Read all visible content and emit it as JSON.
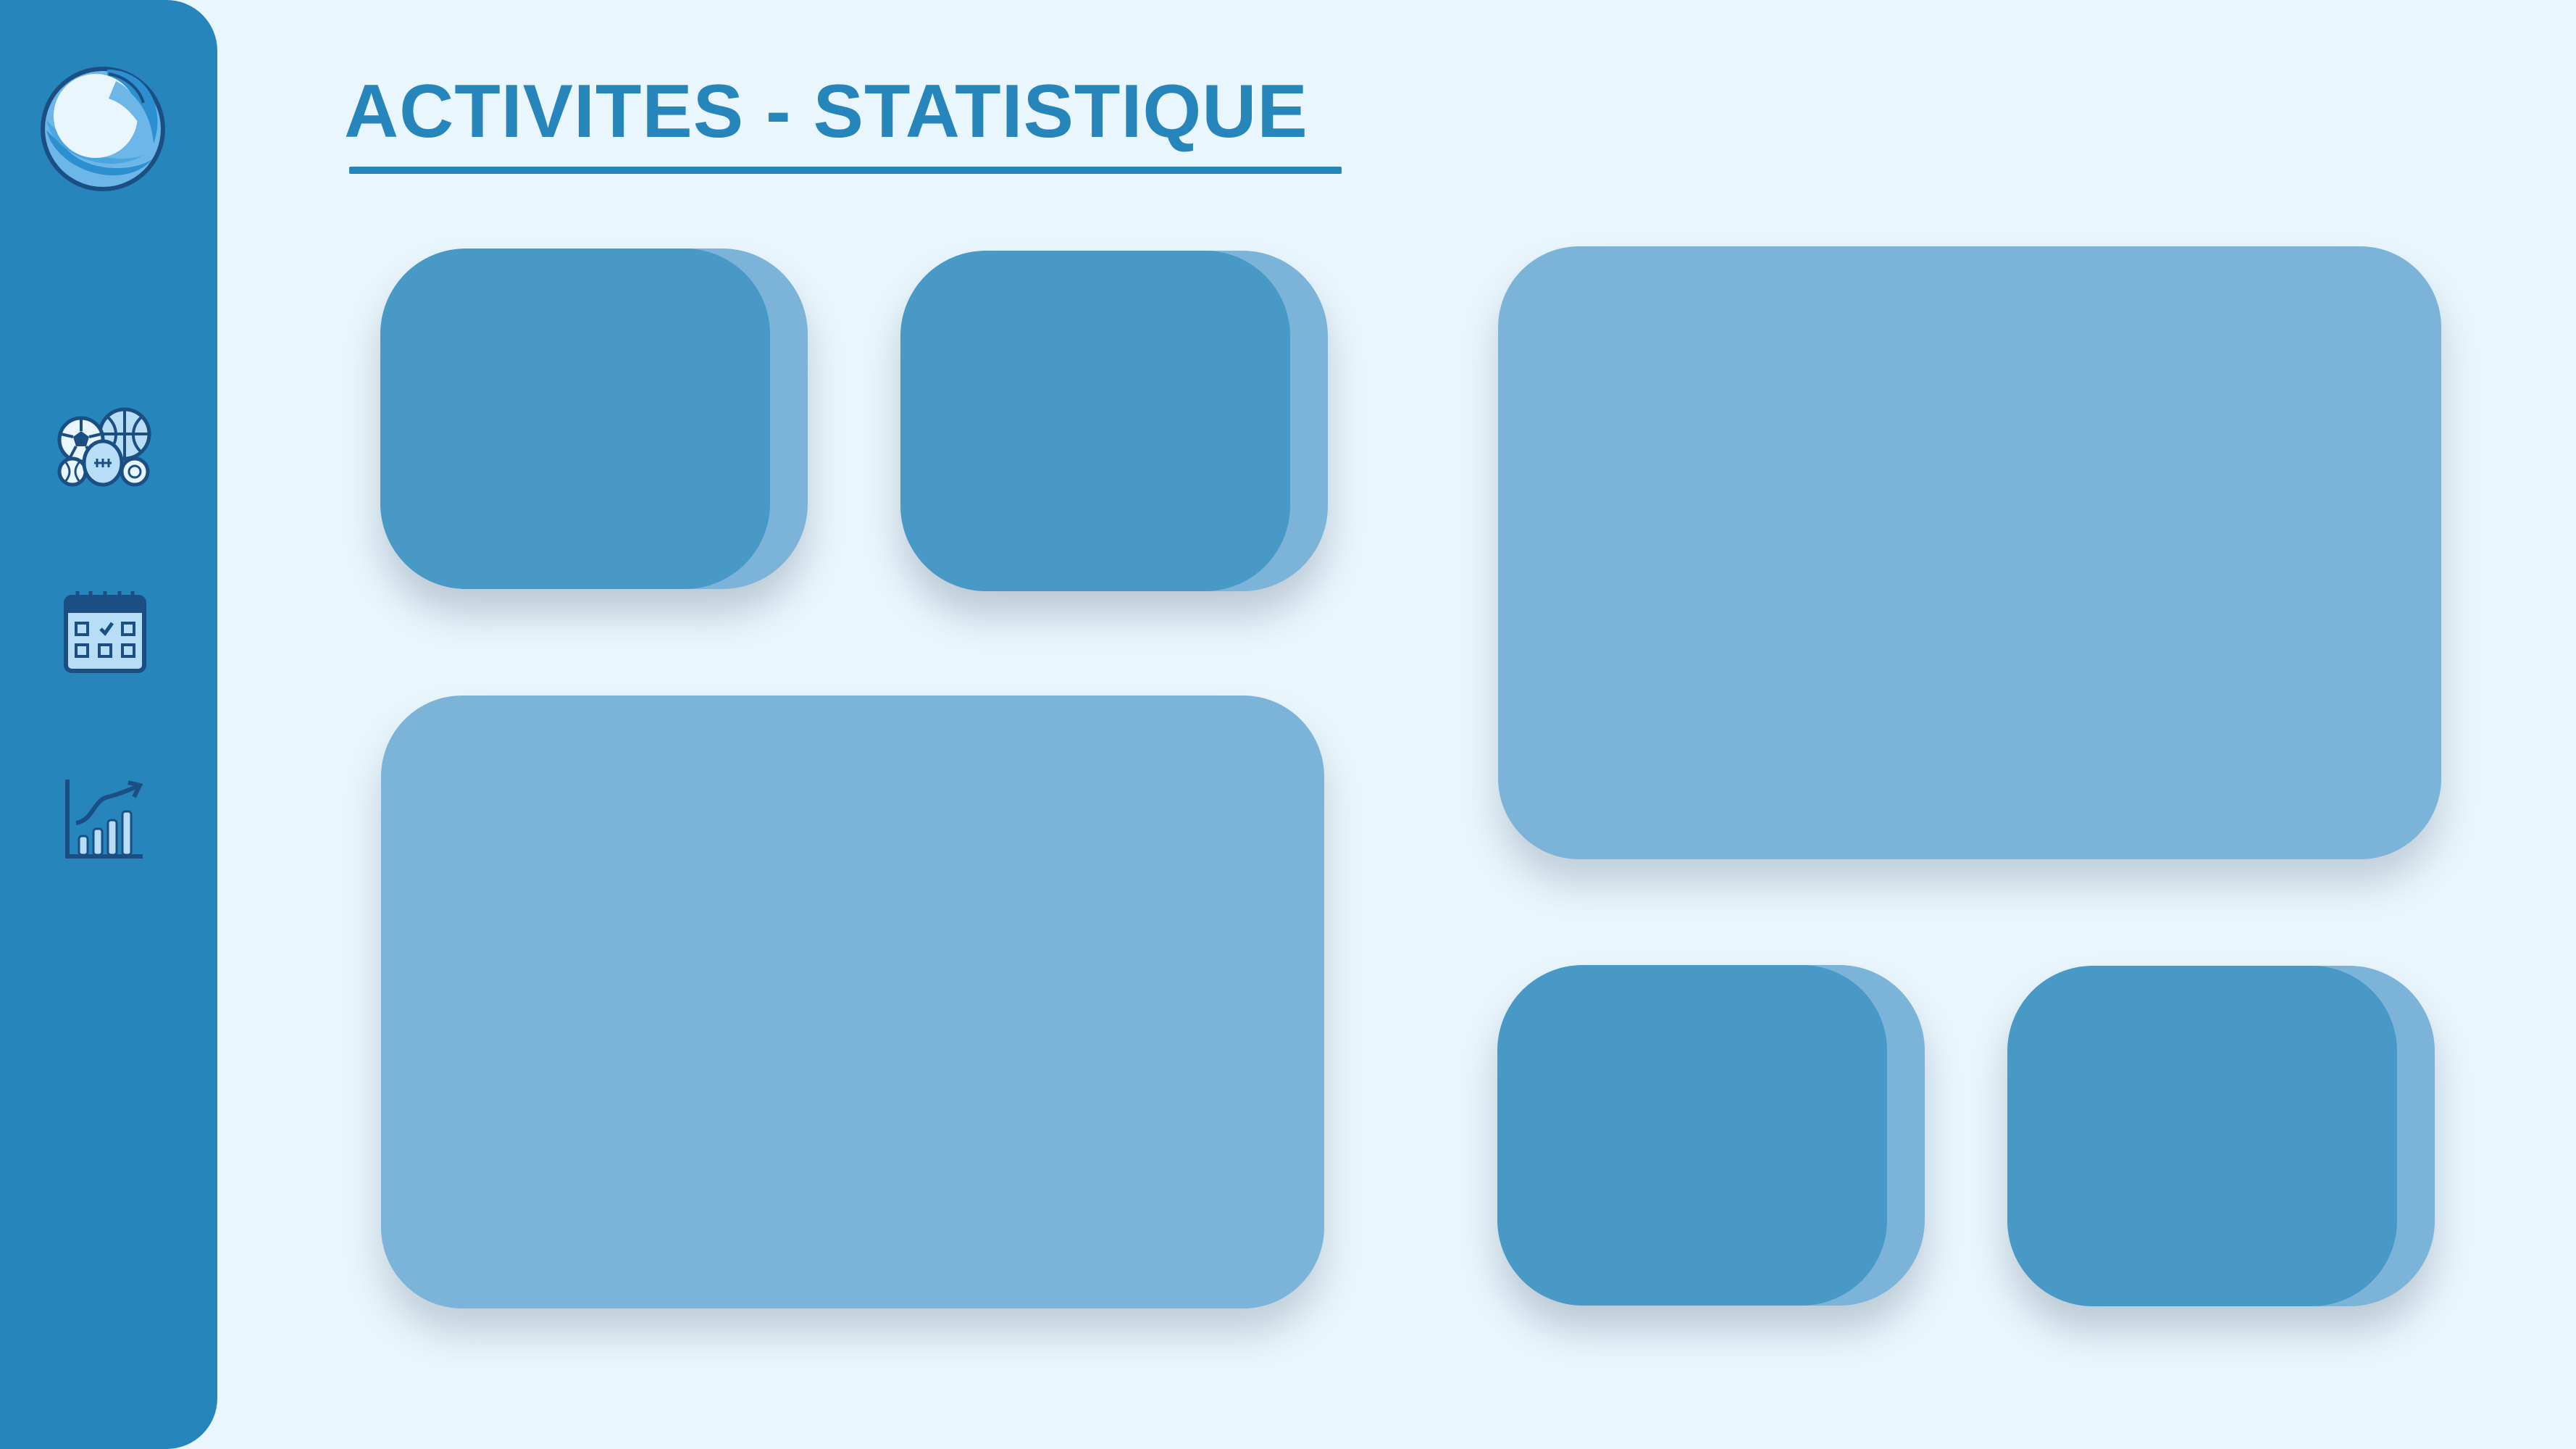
{
  "page": {
    "title": "ACTIVITES - STATISTIQUE"
  },
  "sidebar": {
    "logo_icon": "wave-logo-icon",
    "items": [
      {
        "icon": "sports-balls-icon"
      },
      {
        "icon": "calendar-icon"
      },
      {
        "icon": "statistics-chart-icon"
      }
    ]
  },
  "colors": {
    "sidebar": "#2685bb",
    "background": "#eaf6fd",
    "accent": "#2685bb",
    "card_dark": "#4899c6",
    "card_light": "#7bb4d8",
    "icon_stroke": "#1b4f84",
    "icon_fill": "#b7def6"
  }
}
